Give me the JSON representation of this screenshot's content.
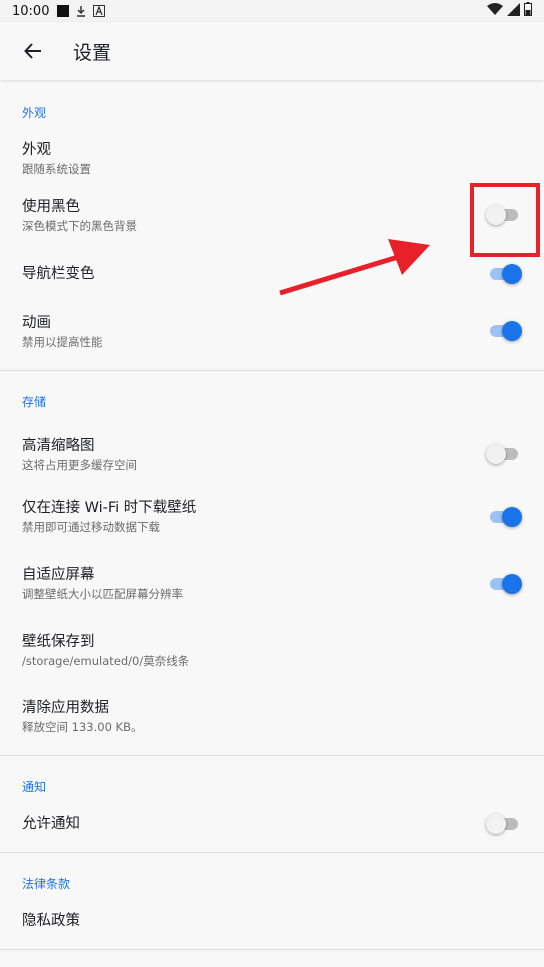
{
  "status_bar": {
    "time": "10:00",
    "icons_left": [
      "square-icon",
      "download-icon",
      "a-badge-icon"
    ],
    "icons_right": [
      "wifi-icon",
      "signal-icon",
      "battery-icon"
    ]
  },
  "app_bar": {
    "title": "设置",
    "back_icon": "arrow-left-icon"
  },
  "sections": {
    "appearance": {
      "header": "外观",
      "items": [
        {
          "title": "外观",
          "summary": "跟随系统设置"
        },
        {
          "title": "使用黑色",
          "summary": "深色模式下的黑色背景",
          "switch": false
        },
        {
          "title": "导航栏变色",
          "switch": true
        },
        {
          "title": "动画",
          "summary": "禁用以提高性能",
          "switch": true
        }
      ]
    },
    "storage": {
      "header": "存储",
      "items": [
        {
          "title": "高清缩略图",
          "summary": "这将占用更多缓存空间",
          "switch": false
        },
        {
          "title": "仅在连接 Wi-Fi 时下载壁纸",
          "summary": "禁用即可通过移动数据下载",
          "switch": true
        },
        {
          "title": "自适应屏幕",
          "summary": "调整壁纸大小以匹配屏幕分辨率",
          "switch": true
        },
        {
          "title": "壁纸保存到",
          "summary": "/storage/emulated/0/莫奈线条"
        },
        {
          "title": "清除应用数据",
          "summary": "释放空间 133.00 KB。"
        }
      ]
    },
    "notifications": {
      "header": "通知",
      "items": [
        {
          "title": "允许通知",
          "switch": false
        }
      ]
    },
    "legal": {
      "header": "法律条款",
      "items": [
        {
          "title": "隐私政策"
        }
      ]
    }
  },
  "colors": {
    "accent": "#1a73e8",
    "annotation": "#e8202a"
  }
}
